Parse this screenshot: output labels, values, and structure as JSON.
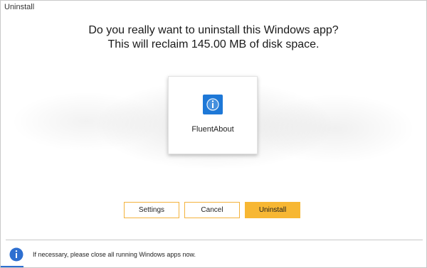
{
  "window": {
    "title": "Uninstall"
  },
  "prompt": {
    "line1": "Do you really want to uninstall this Windows app?",
    "line2": "This will reclaim 145.00 MB of disk space."
  },
  "app": {
    "name": "FluentAbout",
    "icon": "info-icon",
    "icon_color": "#1e78d7"
  },
  "buttons": {
    "settings": "Settings",
    "cancel": "Cancel",
    "uninstall": "Uninstall"
  },
  "footer": {
    "icon": "info-icon",
    "message": "If necessary, please close all running Windows apps now."
  },
  "colors": {
    "accent": "#f7b733",
    "button_border": "#f3b33d",
    "info_blue": "#2e6fd0"
  }
}
